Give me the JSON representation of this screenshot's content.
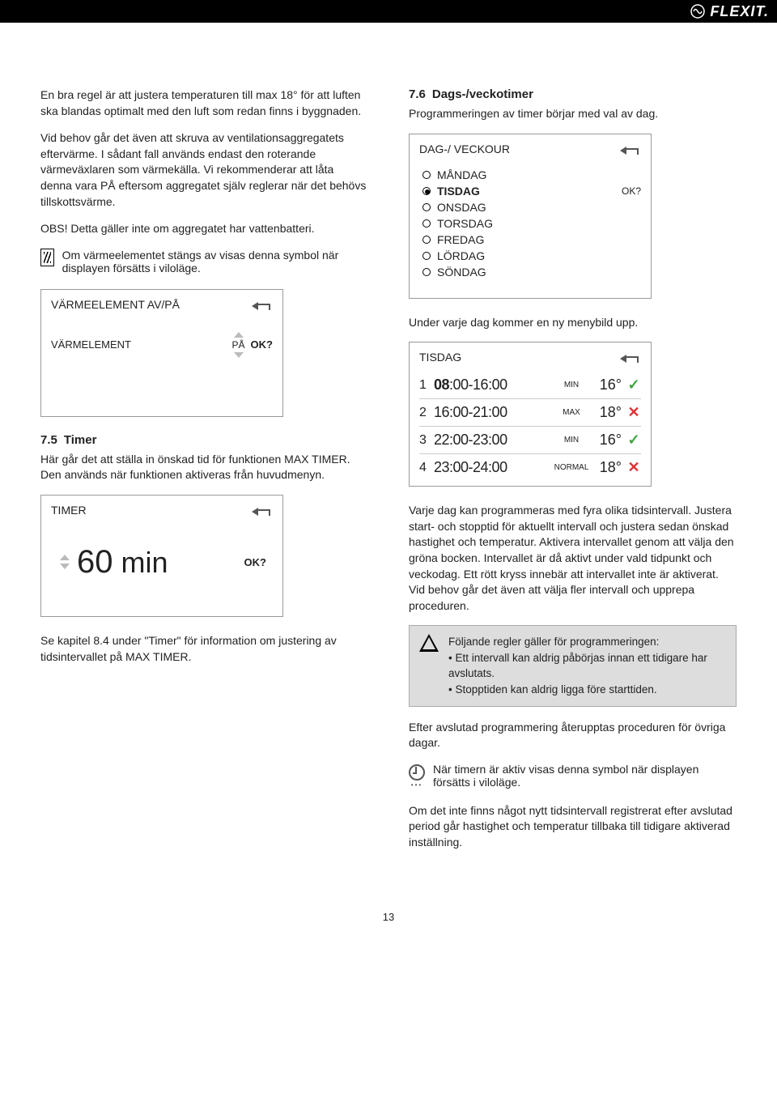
{
  "brand": "FLEXIT.",
  "page_number": "13",
  "left": {
    "intro_p1": "En bra regel är att justera temperaturen till max 18° för att luften ska blandas optimalt med den luft som redan finns i byggnaden.",
    "intro_p2": "Vid behov går det även att skruva av ventilationsaggregatets eftervärme. I sådant fall används endast den roterande värmeväxlaren som värmekälla. Vi rekommenderar att låta denna vara PÅ eftersom aggregatet själv reglerar när det behövs tillskottsvärme.",
    "obs": "OBS! Detta gäller inte om aggregatet har vattenbatteri.",
    "heater_note": "Om värmeelementet stängs av visas denna symbol när displayen försätts i viloläge.",
    "panel_heater": {
      "title": "VÄRMEELEMENT AV/PÅ",
      "row_label": "VÄRMELEMENT",
      "value": "PÅ",
      "ok": "OK?"
    },
    "sec75_title_num": "7.5",
    "sec75_title": "Timer",
    "sec75_p": "Här går det att ställa in önskad tid för funktionen MAX TIMER. Den används när funktionen aktiveras från huvudmenyn.",
    "panel_timer": {
      "title": "TIMER",
      "value": "60",
      "unit": "min",
      "ok": "OK?"
    },
    "sec75_ref": "Se kapitel 8.4 under \"Timer\" för information om justering av tidsintervallet på MAX TIMER."
  },
  "right": {
    "sec76_title_num": "7.6",
    "sec76_title": "Dags-/veckotimer",
    "sec76_intro": "Programmeringen av timer börjar med val av dag.",
    "panel_days": {
      "title": "DAG-/ VECKOUR",
      "ok": "OK?",
      "days": [
        "MÅNDAG",
        "TISDAG",
        "ONSDAG",
        "TORSDAG",
        "FREDAG",
        "LÖRDAG",
        "SÖNDAG"
      ],
      "selected_index": 1
    },
    "under_text": "Under varje dag kommer en ny menybild upp.",
    "panel_sched": {
      "title": "TISDAG",
      "rows": [
        {
          "idx": "1",
          "time_plain": "08",
          "time_rest": ":00-16:00",
          "mode": "MIN",
          "temp": "16°",
          "active": true,
          "bold": true
        },
        {
          "idx": "2",
          "time_plain": "16:00-21:00",
          "time_rest": "",
          "mode": "MAX",
          "temp": "18°",
          "active": false,
          "bold": false
        },
        {
          "idx": "3",
          "time_plain": "22:00-23:00",
          "time_rest": "",
          "mode": "MIN",
          "temp": "16°",
          "active": true,
          "bold": false
        },
        {
          "idx": "4",
          "time_plain": "23:00-24:00",
          "time_rest": "",
          "mode": "NORMAL",
          "temp": "18°",
          "active": false,
          "bold": false
        }
      ]
    },
    "explain_p": "Varje dag kan programmeras med fyra olika tidsintervall. Justera start- och stopptid för aktuellt intervall och justera sedan önskad hastighet och temperatur. Aktivera intervallet genom att välja den gröna bocken. Intervallet är då aktivt under vald tidpunkt och veckodag. Ett rött kryss innebär att intervallet inte är aktiverat. Vid behov går det även att välja fler intervall och upprepa proceduren.",
    "warn_line1": "Följande regler gäller för programmeringen:",
    "warn_b1": "• Ett intervall kan aldrig påbörjas innan ett tidigare har avslutats.",
    "warn_b2": "• Stopptiden kan aldrig ligga före starttiden.",
    "after_p": "Efter avslutad programmering återupptas proceduren för övriga dagar.",
    "clock_note": "När timern är aktiv visas denna symbol när displayen försätts i viloläge.",
    "last_p": "Om det inte finns något nytt tidsintervall registrerat efter avslutad period går hastighet och temperatur tillbaka till tidigare aktiverad inställning."
  }
}
